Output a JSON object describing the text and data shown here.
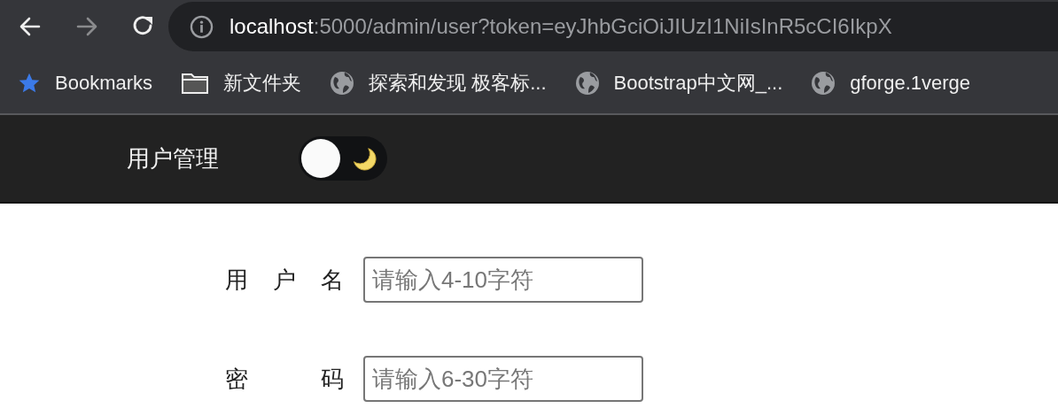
{
  "browser": {
    "nav": [
      {
        "kind": "back",
        "disabled": false
      },
      {
        "kind": "forward",
        "disabled": true
      },
      {
        "kind": "reload",
        "disabled": false
      }
    ],
    "address": {
      "host": "localhost",
      "rest": ":5000/admin/user?token=eyJhbGciOiJIUzI1NiIsInR5cCI6IkpX"
    },
    "bookmarks": [
      {
        "kind": "star",
        "label": "Bookmarks"
      },
      {
        "kind": "folder",
        "label": "新文件夹"
      },
      {
        "kind": "globe",
        "label": "探索和发现 极客标..."
      },
      {
        "kind": "globe",
        "label": "Bootstrap中文网_..."
      },
      {
        "kind": "globe",
        "label": "gforge.1verge"
      }
    ]
  },
  "header": {
    "title": "用户管理",
    "theme_toggle": {
      "on": false
    }
  },
  "form": {
    "fields": [
      {
        "label": "用户名",
        "placeholder": "请输入4-10字符"
      },
      {
        "label": "密码",
        "placeholder": "请输入6-30字符"
      }
    ]
  }
}
